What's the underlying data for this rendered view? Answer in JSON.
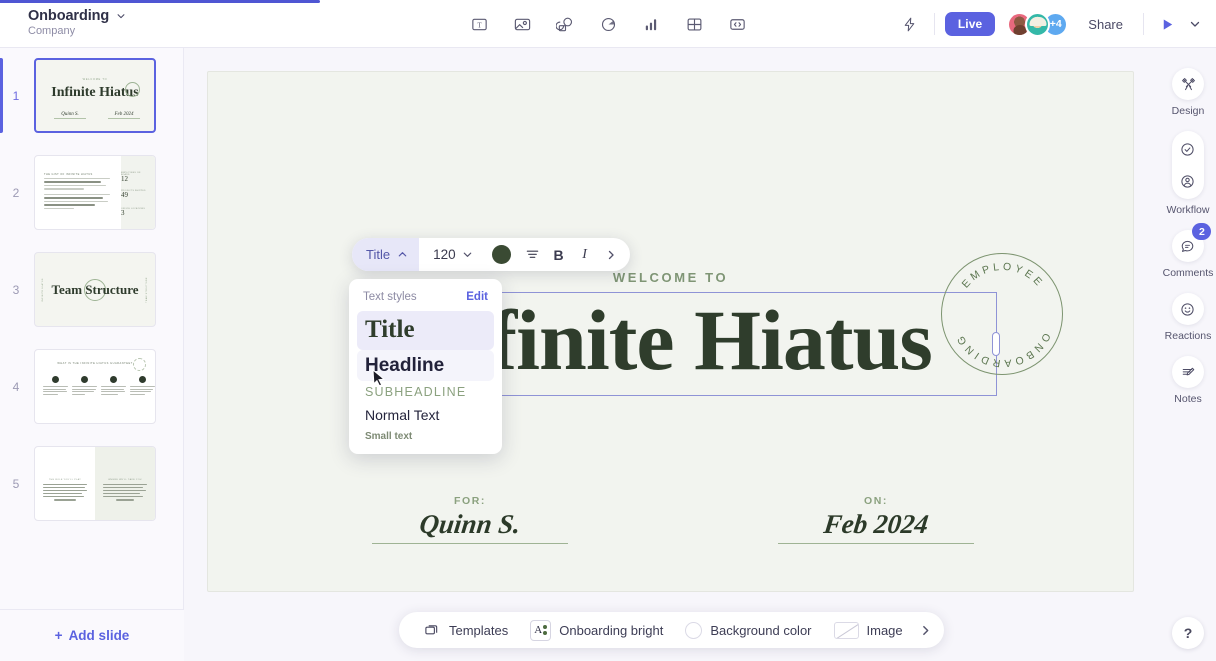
{
  "header": {
    "doc_title": "Onboarding",
    "doc_subtitle": "Company",
    "tools": [
      {
        "name": "text-tool",
        "label": "Text"
      },
      {
        "name": "image-tool",
        "label": "Image"
      },
      {
        "name": "shapes-tool",
        "label": "Shapes"
      },
      {
        "name": "graphic-tool",
        "label": "Graphic"
      },
      {
        "name": "chart-tool",
        "label": "Chart"
      },
      {
        "name": "table-tool",
        "label": "Table"
      },
      {
        "name": "embed-tool",
        "label": "Embed"
      }
    ],
    "live_label": "Live",
    "avatar_overflow": "+4",
    "share_label": "Share"
  },
  "slides_panel": {
    "add_slide_label": "Add slide",
    "slides": [
      {
        "number": "1",
        "kicker": "WELCOME TO",
        "title": "Infinite Hiatus",
        "for_label": "FOR:",
        "for_value": "Quinn S.",
        "on_label": "ON:",
        "on_value": "Feb 2024"
      },
      {
        "number": "2",
        "heading": "THE GIST OF INFINITE HIATUS",
        "stats": [
          {
            "label": "EMPLOYEES ON BOARD",
            "value": "12"
          },
          {
            "label": "PROJECTS SHIPPED",
            "value": "49"
          },
          {
            "label": "OFFICE LOCATIONS",
            "value": "3"
          }
        ]
      },
      {
        "number": "3",
        "title": "Team Structure",
        "side_left": "INFINITE HIATUS",
        "side_right": "TEAM STRUCTURE"
      },
      {
        "number": "4",
        "heading": "WHAT IS THE INFINITE HIATUS GUARANTEE?"
      },
      {
        "number": "5",
        "left_heading": "THE ROLE YOU'LL PLAY",
        "right_heading": "WHERE WE'LL TAKE YOU"
      }
    ]
  },
  "canvas": {
    "kicker": "WELCOME TO",
    "title": "Infinite Hiatus",
    "stamp_top_text": "EMPLOYEE",
    "stamp_bottom_text": "ONBOARDING",
    "fields": [
      {
        "label": "FOR:",
        "value": "Quinn S."
      },
      {
        "label": "ON:",
        "value": "Feb 2024"
      }
    ]
  },
  "format_toolbar": {
    "style_name": "Title",
    "font_size": "120",
    "text_color": "#3a4a33",
    "bold_label": "B",
    "italic_label": "I"
  },
  "styles_menu": {
    "heading": "Text styles",
    "edit_label": "Edit",
    "items": [
      {
        "label": "Title",
        "state": "selected"
      },
      {
        "label": "Headline",
        "state": "hovered"
      },
      {
        "label": "SUBHEADLINE",
        "state": "normal"
      },
      {
        "label": "Normal Text",
        "state": "normal"
      },
      {
        "label": "Small text",
        "state": "normal"
      }
    ]
  },
  "bottom_bar": {
    "templates_label": "Templates",
    "theme_label": "Onboarding bright",
    "background_label": "Background color",
    "image_label": "Image"
  },
  "right_rail": {
    "items": [
      {
        "label": "Design",
        "icon": "design-tools-icon"
      },
      {
        "label": "Workflow",
        "icon": "workflow-icon"
      },
      {
        "label": "Comments",
        "icon": "comment-icon",
        "badge": "2"
      },
      {
        "label": "Reactions",
        "icon": "smiley-icon"
      },
      {
        "label": "Notes",
        "icon": "notes-pencil-icon"
      }
    ],
    "help_label": "?"
  },
  "colors": {
    "accent": "#5b62e0",
    "brand_green": "#2f3d2c",
    "sage": "#8ba17f",
    "slide_bg": "#f2f4ef"
  }
}
